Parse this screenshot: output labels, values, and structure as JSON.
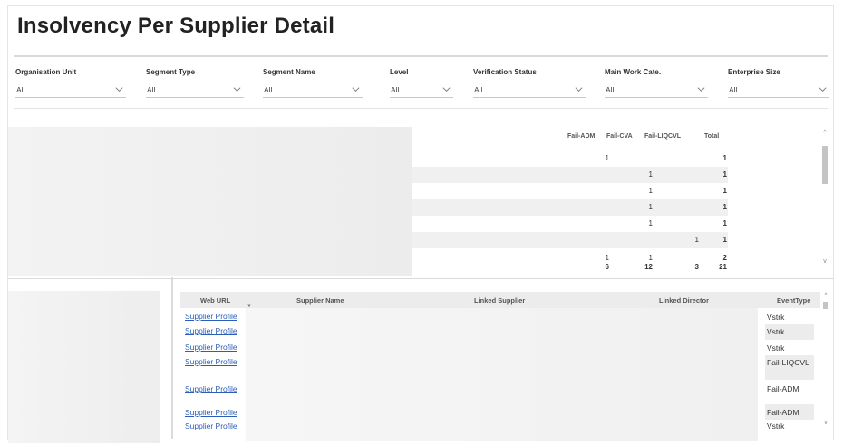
{
  "page": {
    "title": "Insolvency Per Supplier Detail"
  },
  "slicers": [
    {
      "label": "Organisation Unit",
      "value": "All"
    },
    {
      "label": "Segment Type",
      "value": "All"
    },
    {
      "label": "Segment Name",
      "value": "All"
    },
    {
      "label": "Level",
      "value": "All"
    },
    {
      "label": "Verification Status",
      "value": "All"
    },
    {
      "label": "Main Work Cate.",
      "value": "All"
    },
    {
      "label": "Enterprise Size",
      "value": "All"
    }
  ],
  "matrix": {
    "headers": [
      "Fail-ADM",
      "Fail-CVA",
      "Fail-LIQCVL",
      "Total"
    ],
    "rows": [
      [
        "1",
        "",
        "",
        "1"
      ],
      [
        "",
        "1",
        "",
        "1"
      ],
      [
        "",
        "1",
        "",
        "1"
      ],
      [
        "",
        "1",
        "",
        "1"
      ],
      [
        "",
        "1",
        "",
        "1"
      ],
      [
        "",
        "",
        "1",
        "1"
      ],
      [
        "1",
        "1",
        "",
        "2"
      ],
      [
        "6",
        "12",
        "3",
        "21"
      ]
    ]
  },
  "detail_table": {
    "headers": {
      "web_url": "Web URL",
      "supplier_name": "Supplier Name",
      "linked_supplier": "Linked Supplier",
      "linked_director": "Linked Director",
      "event_type": "EventType"
    },
    "rows": [
      {
        "web_url": "Supplier Profile",
        "event_type": "Vstrk"
      },
      {
        "web_url": "Supplier Profile",
        "event_type": "Vstrk"
      },
      {
        "web_url": "Supplier Profile",
        "event_type": "Vstrk"
      },
      {
        "web_url": "Supplier Profile",
        "event_type": "Fail-LIQCVL"
      },
      {
        "web_url": "Supplier Profile",
        "event_type": "Fail-ADM"
      },
      {
        "web_url": "Supplier Profile",
        "event_type": "Fail-ADM"
      },
      {
        "web_url": "Supplier Profile",
        "event_type": "Vstrk"
      }
    ]
  },
  "icons": {
    "dropdown": "chevron-down-icon",
    "scroll_up": "scroll-up-arrow-icon",
    "scroll_down": "scroll-down-arrow-icon",
    "sort": "sort-desc-icon"
  }
}
